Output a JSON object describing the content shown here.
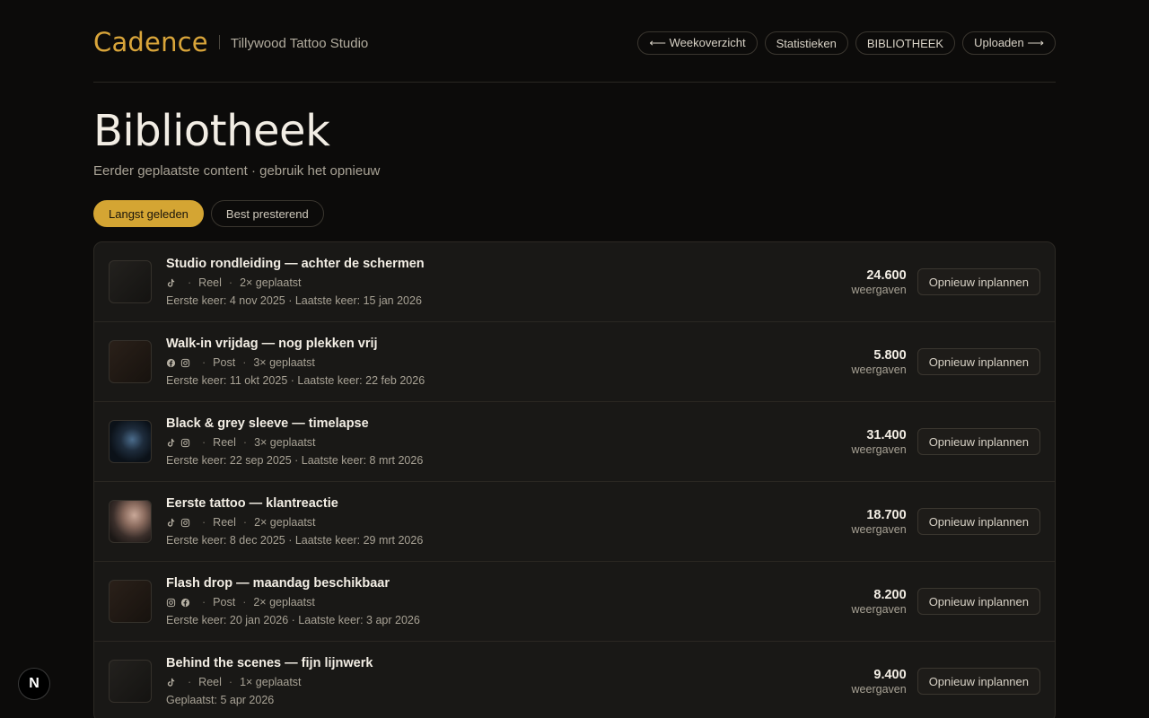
{
  "header": {
    "brand": "Cadence",
    "studio": "Tillywood Tattoo Studio",
    "nav": [
      {
        "label": "⟵ Weekoverzicht"
      },
      {
        "label": "Statistieken"
      },
      {
        "label": "BIBLIOTHEEK"
      },
      {
        "label": "Uploaden ⟶"
      }
    ]
  },
  "page": {
    "title": "Bibliotheek",
    "subtitle": "Eerder geplaatste content · gebruik het opnieuw"
  },
  "filters": {
    "active": "Langst geleden",
    "inactive": "Best presterend"
  },
  "items": [
    {
      "title": "Studio rondleiding — achter de schermen",
      "platforms": [
        "tiktok-icon"
      ],
      "type": "Reel",
      "count": "2× geplaatst",
      "dates": "Eerste keer: 4 nov 2025 · Laatste keer: 15 jan 2026",
      "views": "24.600",
      "views_label": "weergaven",
      "action": "Opnieuw inplannen",
      "thumb": "dark"
    },
    {
      "title": "Walk-in vrijdag — nog plekken vrij",
      "platforms": [
        "facebook-icon",
        "instagram-icon"
      ],
      "type": "Post",
      "count": "3× geplaatst",
      "dates": "Eerste keer: 11 okt 2025 · Laatste keer: 22 feb 2026",
      "views": "5.800",
      "views_label": "weergaven",
      "action": "Opnieuw inplannen",
      "thumb": "brown"
    },
    {
      "title": "Black & grey sleeve — timelapse",
      "platforms": [
        "tiktok-icon",
        "instagram-icon"
      ],
      "type": "Reel",
      "count": "3× geplaatst",
      "dates": "Eerste keer: 22 sep 2025 · Laatste keer: 8 mrt 2026",
      "views": "31.400",
      "views_label": "weergaven",
      "action": "Opnieuw inplannen",
      "thumb": "photo-blue"
    },
    {
      "title": "Eerste tattoo — klantreactie",
      "platforms": [
        "tiktok-icon",
        "instagram-icon"
      ],
      "type": "Reel",
      "count": "2× geplaatst",
      "dates": "Eerste keer: 8 dec 2025 · Laatste keer: 29 mrt 2026",
      "views": "18.700",
      "views_label": "weergaven",
      "action": "Opnieuw inplannen",
      "thumb": "photo-neck"
    },
    {
      "title": "Flash drop — maandag beschikbaar",
      "platforms": [
        "instagram-icon",
        "facebook-icon"
      ],
      "type": "Post",
      "count": "2× geplaatst",
      "dates": "Eerste keer: 20 jan 2026 · Laatste keer: 3 apr 2026",
      "views": "8.200",
      "views_label": "weergaven",
      "action": "Opnieuw inplannen",
      "thumb": "brown"
    },
    {
      "title": "Behind the scenes — fijn lijnwerk",
      "platforms": [
        "tiktok-icon"
      ],
      "type": "Reel",
      "count": "1× geplaatst",
      "dates": "Geplaatst: 5 apr 2026",
      "views": "9.400",
      "views_label": "weergaven",
      "action": "Opnieuw inplannen",
      "thumb": "dark"
    }
  ],
  "dev_badge": "N",
  "colors": {
    "accent": "#d4a533",
    "background": "#0c0b0a",
    "card": "#191816"
  }
}
